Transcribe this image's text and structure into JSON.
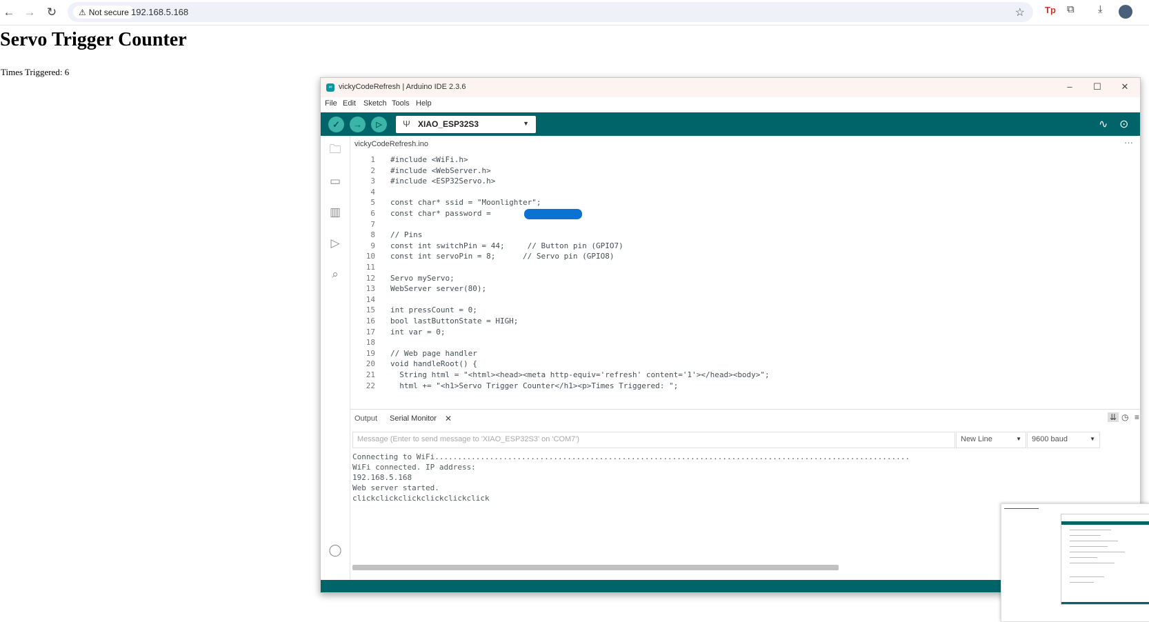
{
  "browser": {
    "security_label": "Not secure",
    "url": "192.168.5.168"
  },
  "page": {
    "title": "Servo Trigger Counter",
    "count_text": "Times Triggered: 6"
  },
  "ide": {
    "window_title": "vickyCodeRefresh | Arduino IDE 2.3.6",
    "app_icon_text": "∞",
    "menu": [
      "File",
      "Edit",
      "Sketch",
      "Tools",
      "Help"
    ],
    "board": "XIAO_ESP32S3",
    "file_tab": "vickyCodeRefresh.ino",
    "code_lines": [
      {
        "n": "1",
        "text": "#include <WiFi.h>"
      },
      {
        "n": "2",
        "text": "#include <WebServer.h>"
      },
      {
        "n": "3",
        "text": "#include <ESP32Servo.h>"
      },
      {
        "n": "4",
        "text": ""
      },
      {
        "n": "5",
        "text": "const char* ssid = \"Moonlighter\";"
      },
      {
        "n": "6",
        "text": "const char* password = "
      },
      {
        "n": "7",
        "text": ""
      },
      {
        "n": "8",
        "text": "// Pins"
      },
      {
        "n": "9",
        "text": "const int switchPin = 44;     // Button pin (GPIO7)"
      },
      {
        "n": "10",
        "text": "const int servoPin = 8;      // Servo pin (GPIO8)"
      },
      {
        "n": "11",
        "text": ""
      },
      {
        "n": "12",
        "text": "Servo myServo;"
      },
      {
        "n": "13",
        "text": "WebServer server(80);"
      },
      {
        "n": "14",
        "text": ""
      },
      {
        "n": "15",
        "text": "int pressCount = 0;"
      },
      {
        "n": "16",
        "text": "bool lastButtonState = HIGH;"
      },
      {
        "n": "17",
        "text": "int var = 0;"
      },
      {
        "n": "18",
        "text": ""
      },
      {
        "n": "19",
        "text": "// Web page handler"
      },
      {
        "n": "20",
        "text": "void handleRoot() {"
      },
      {
        "n": "21",
        "text": "  String html = \"<html><head><meta http-equiv='refresh' content='1'></head><body>\";"
      },
      {
        "n": "22",
        "text": "  html += \"<h1>Servo Trigger Counter</h1><p>Times Triggered: \";"
      }
    ],
    "panel": {
      "tab_output": "Output",
      "tab_serial": "Serial Monitor",
      "message_placeholder": "Message (Enter to send message to 'XIAO_ESP32S3' on 'COM7')",
      "line_ending": "New Line",
      "baud": "9600 baud",
      "serial_lines": [
        "Connecting to WiFi........................................................................................................",
        "WiFi connected. IP address:",
        "192.168.5.168",
        "Web server started.",
        "clickclickclickclickclickclick"
      ]
    }
  },
  "colors": {
    "toolbar_teal": "#006468",
    "button_teal": "#3cb5a8",
    "redaction_blue": "#0b72d1"
  },
  "icons": [
    "back-arrow-icon",
    "forward-arrow-icon",
    "reload-icon",
    "warning-icon",
    "star-icon",
    "extensions-icon",
    "download-icon",
    "verify-icon",
    "upload-icon",
    "debug-icon",
    "usb-icon",
    "serial-plotter-icon",
    "serial-monitor-icon",
    "folder-icon",
    "board-manager-icon",
    "library-icon",
    "debug-sidebar-icon",
    "search-icon",
    "account-icon"
  ]
}
